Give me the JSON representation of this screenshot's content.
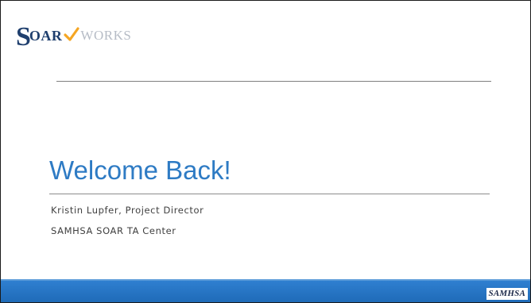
{
  "logo": {
    "s": "S",
    "oar": "OAR",
    "works": "WORKS",
    "brand_navy": "#1f3f6e",
    "brand_orange": "#f5a623",
    "brand_grey": "#b6bcc6"
  },
  "slide": {
    "title": "Welcome Back!",
    "subtitle_line1": "Kristin Lupfer, Project Director",
    "subtitle_line2": "SAMHSA SOAR TA Center",
    "title_color": "#2e7bc4"
  },
  "footer": {
    "logo_text": "SAMHSA",
    "bar_color": "#1f6bb8"
  }
}
